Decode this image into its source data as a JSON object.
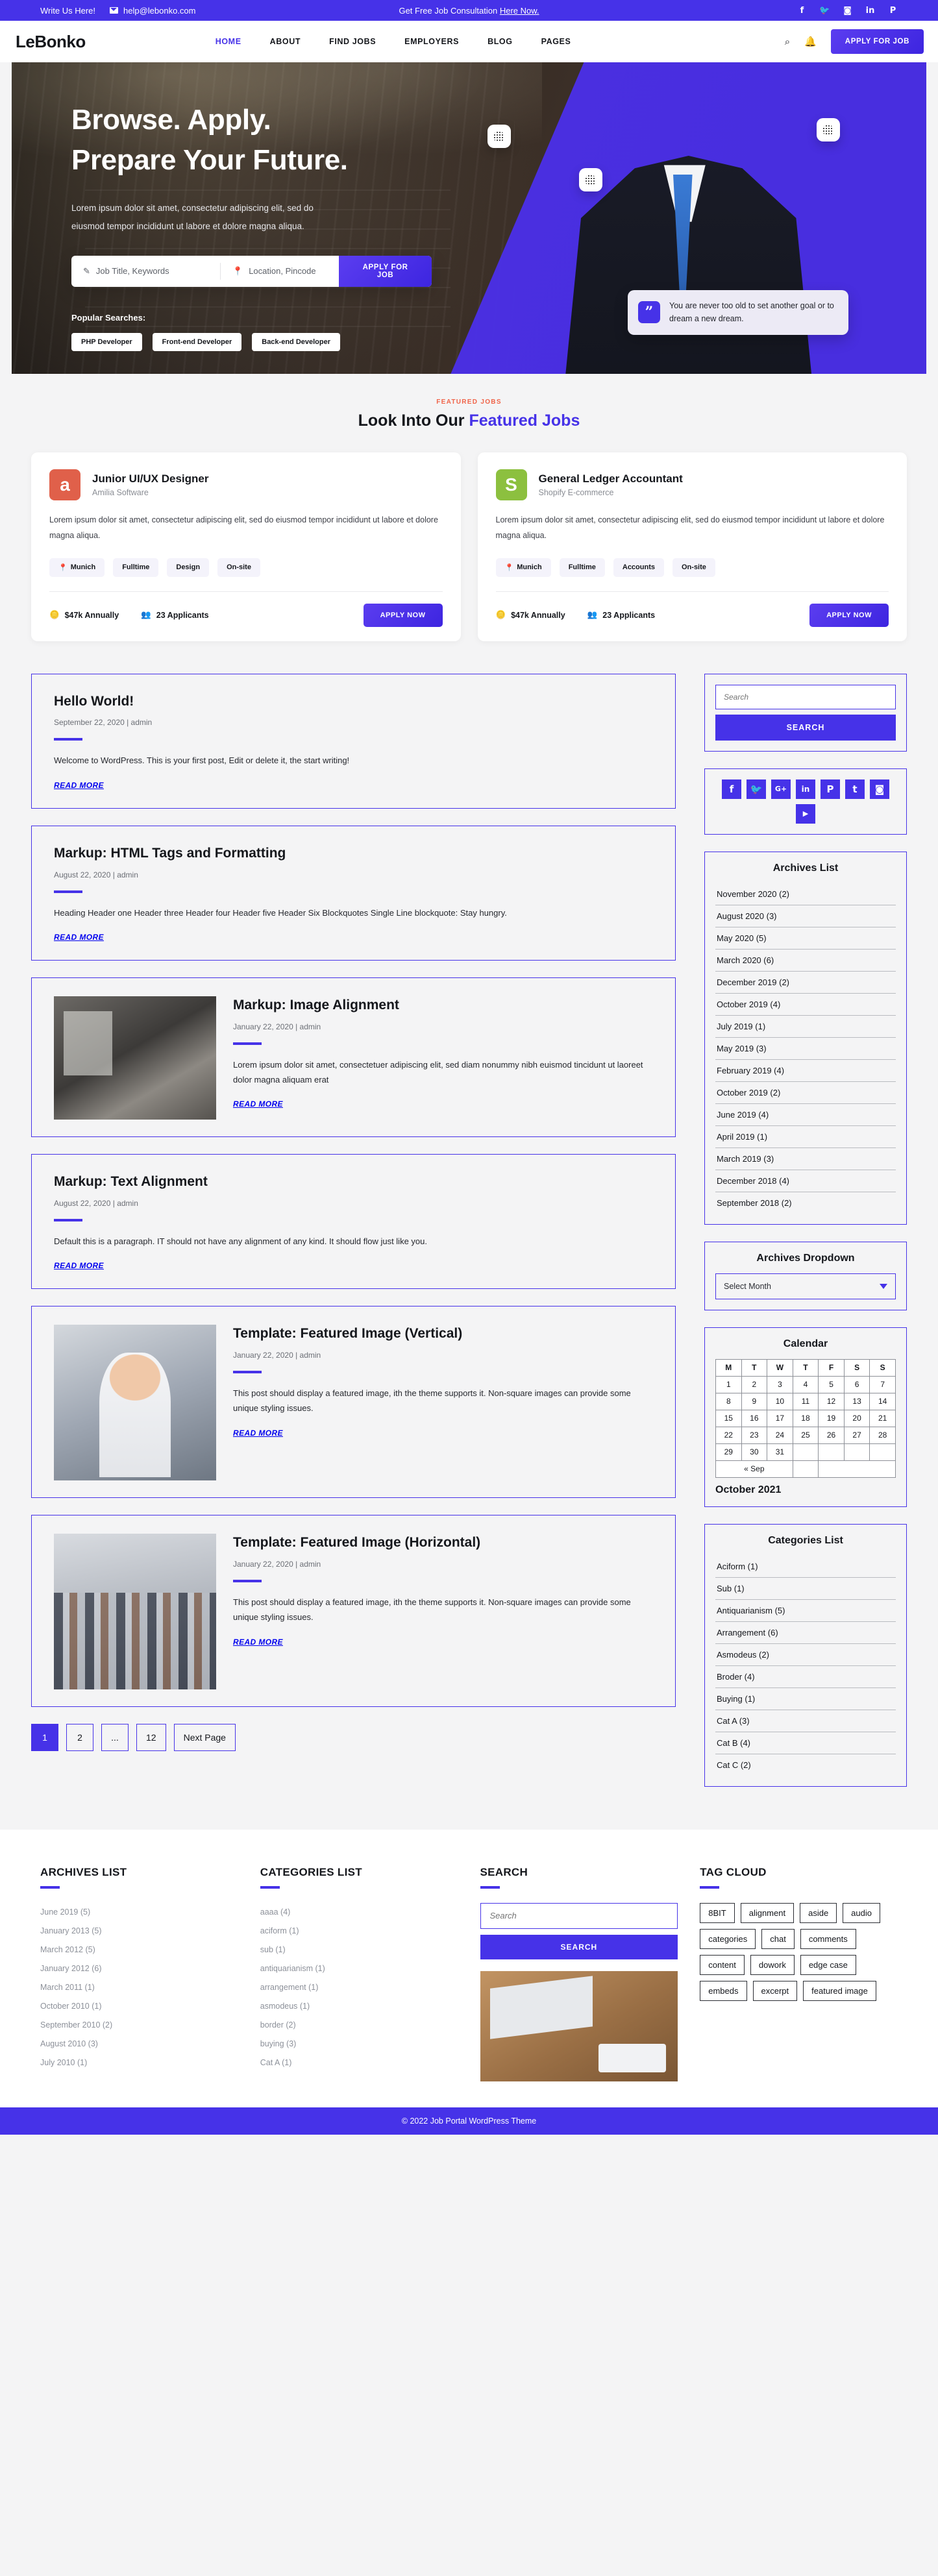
{
  "topbar": {
    "write_us": "Write Us Here!",
    "email": "help@lebonko.com",
    "consultation_text": "Get Free Job Consultation",
    "consultation_link": "Here Now.",
    "socials": [
      "facebook-icon",
      "twitter-icon",
      "instagram-icon",
      "linkedin-icon",
      "pinterest-icon"
    ]
  },
  "nav": {
    "logo": "LeBonko",
    "items": [
      {
        "label": "HOME",
        "active": true
      },
      {
        "label": "ABOUT",
        "active": false
      },
      {
        "label": "FIND JOBS",
        "active": false
      },
      {
        "label": "EMPLOYERS",
        "active": false
      },
      {
        "label": "BLOG",
        "active": false
      },
      {
        "label": "PAGES",
        "active": false
      }
    ],
    "apply_label": "APPLY FOR JOB"
  },
  "hero": {
    "line1": "Browse. Apply.",
    "line2": "Prepare Your Future.",
    "paragraph": "Lorem ipsum dolor sit amet, consectetur adipiscing elit, sed do eiusmod tempor incididunt ut labore et dolore magna aliqua.",
    "search_job_placeholder": "Job Title, Keywords",
    "search_loc_placeholder": "Location, Pincode",
    "search_button": "APPLY FOR JOB",
    "popular_label": "Popular Searches:",
    "popular_chips": [
      "PHP Developer",
      "Front-end Developer",
      "Back-end Developer"
    ],
    "quote": "You are never too old to set another goal or to dream a new dream."
  },
  "featured": {
    "eyebrow": "FEATURED JOBS",
    "title_plain": "Look Into Our ",
    "title_highlight": "Featured Jobs",
    "jobs": [
      {
        "logo_letter": "a",
        "logo_color": "#e0604a",
        "title": "Junior UI/UX Designer",
        "company": "Amilia Software",
        "description": "Lorem ipsum dolor sit amet, consectetur adipiscing elit, sed do eiusmod tempor incididunt ut labore et dolore magna aliqua.",
        "tags": [
          "Munich",
          "Fulltime",
          "Design",
          "On-site"
        ],
        "salary": "$47k Annually",
        "applicants": "23 Applicants",
        "apply_label": "APPLY NOW"
      },
      {
        "logo_letter": "S",
        "logo_color": "#8cc03f",
        "title": "General Ledger Accountant",
        "company": "Shopify E-commerce",
        "description": "Lorem ipsum dolor sit amet, consectetur adipiscing elit, sed do eiusmod tempor incididunt ut labore et dolore magna aliqua.",
        "tags": [
          "Munich",
          "Fulltime",
          "Accounts",
          "On-site"
        ],
        "salary": "$47k Annually",
        "applicants": "23 Applicants",
        "apply_label": "APPLY NOW"
      }
    ]
  },
  "posts": [
    {
      "title": "Hello World!",
      "meta": "September 22, 2020 | admin",
      "body": "Welcome to WordPress. This is your first post, Edit or delete it, the start writing!",
      "read_more": "READ MORE",
      "image": null
    },
    {
      "title": "Markup: HTML Tags and Formatting",
      "meta": "August 22, 2020 | admin",
      "body": "Heading Header one Header three Header four Header five Header Six Blockquotes Single Line blockquote: Stay hungry.",
      "read_more": "READ MORE",
      "image": null
    },
    {
      "title": "Markup: Image Alignment",
      "meta": "January 22, 2020 | admin",
      "body": "Lorem ipsum dolor sit amet, consectetuer adipiscing elit, sed diam nonummy nibh euismod tincidunt ut laoreet dolor magna aliquam erat",
      "read_more": "READ MORE",
      "image": "office-presentation-photo"
    },
    {
      "title": "Markup: Text Alignment",
      "meta": "August 22, 2020 | admin",
      "body": "Default this is a paragraph. IT should not have any alignment of any kind. It should flow just like you.",
      "read_more": "READ MORE",
      "image": null
    },
    {
      "title": "Template: Featured Image (Vertical)",
      "meta": "January 22, 2020 | admin",
      "body": "This post should display a featured image, ith the theme supports it. Non-square images can provide some unique styling issues.",
      "read_more": "READ MORE",
      "image": "woman-portrait-photo"
    },
    {
      "title": "Template: Featured Image (Horizontal)",
      "meta": "January 22, 2020 | admin",
      "body": "This post should display a featured image, ith the theme supports it. Non-square images can provide some unique styling issues.",
      "read_more": "READ MORE",
      "image": "crowd-handshake-photo"
    }
  ],
  "pagination": [
    "1",
    "2",
    "...",
    "12",
    "Next Page"
  ],
  "sidebar": {
    "search": {
      "placeholder": "Search",
      "button": "SEARCH"
    },
    "socials": [
      "facebook-icon",
      "twitter-icon",
      "google-plus-icon",
      "linkedin-icon",
      "pinterest-icon",
      "tumblr-icon",
      "instagram-icon",
      "youtube-icon"
    ],
    "archives_title": "Archives List",
    "archives": [
      "November 2020 (2)",
      "August 2020 (3)",
      "May 2020 (5)",
      "March 2020 (6)",
      "December 2019 (2)",
      "October 2019 (4)",
      "July 2019 (1)",
      "May 2019 (3)",
      "February 2019 (4)",
      "October 2019 (2)",
      "June 2019 (4)",
      "April 2019 (1)",
      "March 2019 (3)",
      "December 2018 (4)",
      "September 2018 (2)"
    ],
    "dropdown_title": "Archives Dropdown",
    "dropdown_value": "Select Month",
    "calendar": {
      "title": "Calendar",
      "weekdays": [
        "M",
        "T",
        "W",
        "T",
        "F",
        "S",
        "S"
      ],
      "weeks": [
        [
          "1",
          "2",
          "3",
          "4",
          "5",
          "6",
          "7"
        ],
        [
          "8",
          "9",
          "10",
          "11",
          "12",
          "13",
          "14"
        ],
        [
          "15",
          "16",
          "17",
          "18",
          "19",
          "20",
          "21"
        ],
        [
          "22",
          "23",
          "24",
          "25",
          "26",
          "27",
          "28"
        ],
        [
          "29",
          "30",
          "31",
          "",
          "",
          "",
          ""
        ]
      ],
      "prev": "« Sep",
      "month_label": "October 2021"
    },
    "categories_title": "Categories List",
    "categories": [
      "Aciform (1)",
      "Sub (1)",
      "Antiquarianism (5)",
      "Arrangement (6)",
      "Asmodeus (2)",
      "Broder (4)",
      "Buying (1)",
      "Cat A (3)",
      "Cat B (4)",
      "Cat C (2)"
    ]
  },
  "footer": {
    "archives_title": "ARCHIVES LIST",
    "archives": [
      "June 2019 (5)",
      "January  2013 (5)",
      "March 2012 (5)",
      "January  2012 (6)",
      "March  2011 (1)",
      "October 2010 (1)",
      "September 2010 (2)",
      "August 2010 (3)",
      "July 2010 (1)"
    ],
    "categories_title": "CATEGORIES LIST",
    "categories": [
      "aaaa (4)",
      "aciform (1)",
      "sub (1)",
      "antiquarianism (1)",
      "arrangement (1)",
      "asmodeus (1)",
      "border (2)",
      "buying (3)",
      "Cat A (1)"
    ],
    "search_title": "SEARCH",
    "search_placeholder": "Search",
    "search_button": "SEARCH",
    "tagcloud_title": "TAG CLOUD",
    "tags": [
      "8BIT",
      "alignment",
      "aside",
      "audio",
      "categories",
      "chat",
      "comments",
      "content",
      "dowork",
      "edge case",
      "embeds",
      "excerpt",
      "featured image"
    ],
    "copyright": "© 2022 Job Portal WordPress Theme"
  },
  "colors": {
    "brand": "#4632e8",
    "accent_orange": "#f06449",
    "green": "#8cc03f",
    "red": "#e0604a"
  }
}
